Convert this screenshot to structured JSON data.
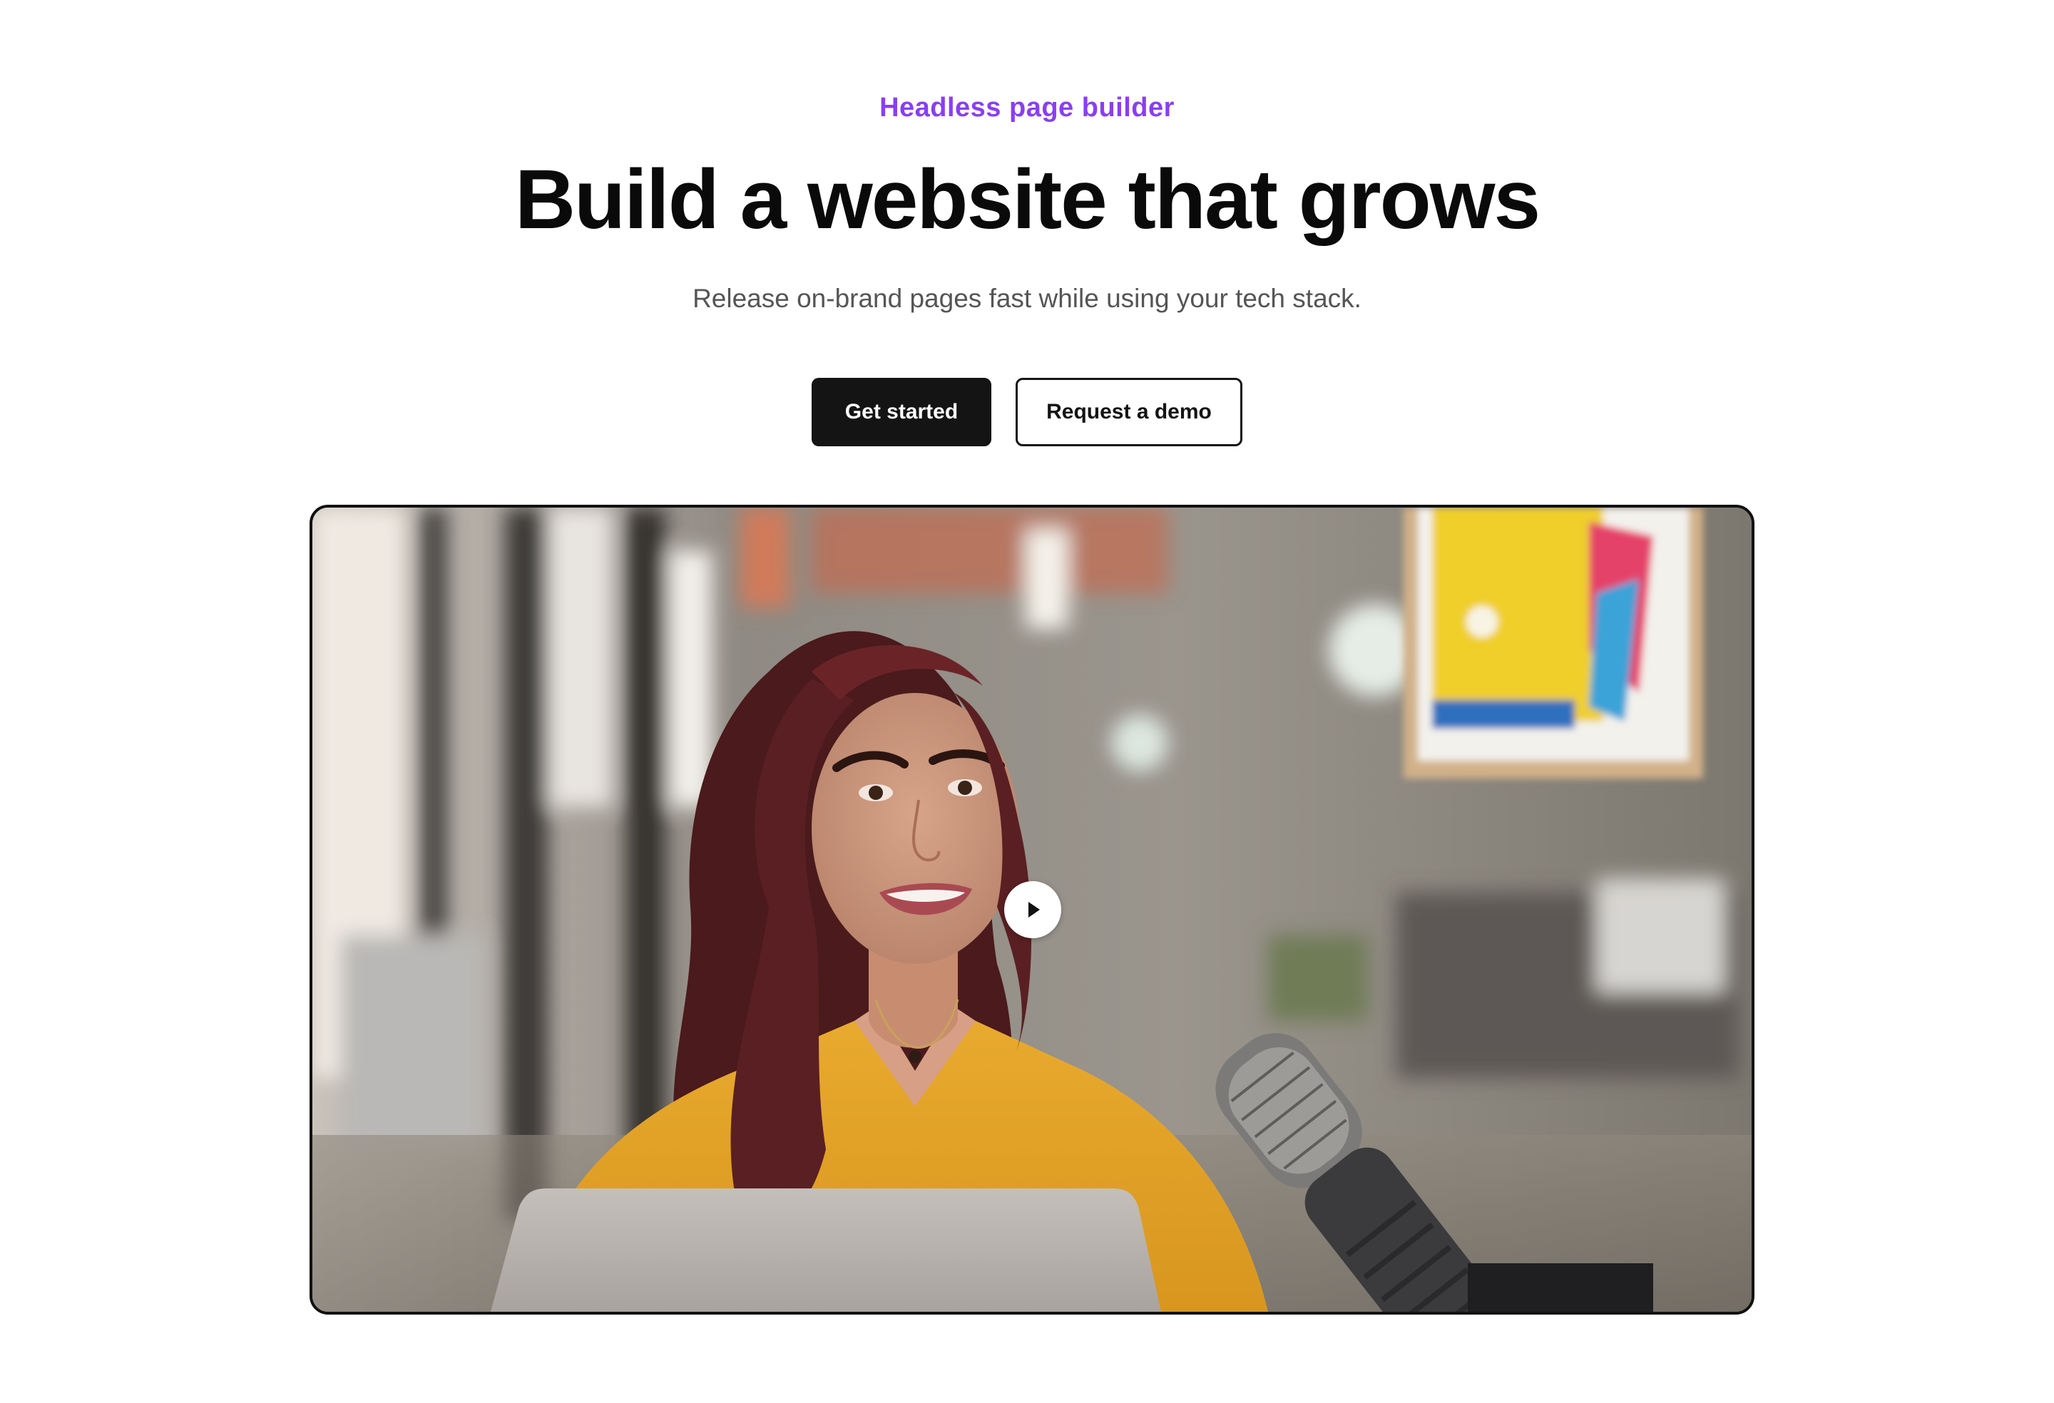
{
  "hero": {
    "eyebrow": "Headless page builder",
    "title": "Build a website that grows",
    "subtitle": "Release on-brand pages fast while using your tech stack."
  },
  "cta": {
    "primary_label": "Get started",
    "secondary_label": "Request a demo"
  },
  "video": {
    "play_icon": "play-icon",
    "thumbnail": "woman-speaking-into-microphone-in-office"
  },
  "colors": {
    "accent": "#8a3ff0",
    "primary_button": "#141414",
    "background": "#ffffff"
  }
}
